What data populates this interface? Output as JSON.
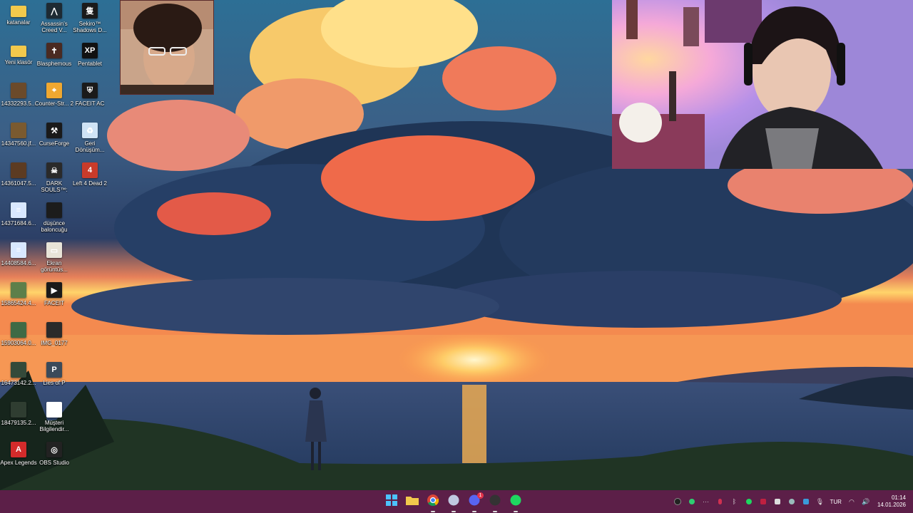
{
  "desktop": {
    "icons_col1": [
      {
        "label": "katanalar",
        "icon": "folder-icon",
        "color": "#f2c94c"
      },
      {
        "label": "Yeni klasör",
        "icon": "folder-icon",
        "color": "#f2c94c"
      },
      {
        "label": "14332293.5...",
        "icon": "image-file-icon",
        "color": "#6b4a2a"
      },
      {
        "label": "14347560.jf...",
        "icon": "image-file-icon",
        "color": "#7a5a30"
      },
      {
        "label": "14361047.5...",
        "icon": "image-file-icon",
        "color": "#5c3b22"
      },
      {
        "label": "14371684.6...",
        "icon": "document-icon",
        "color": "#d9e8ff"
      },
      {
        "label": "14408584.6...",
        "icon": "document-icon",
        "color": "#d9e8ff"
      },
      {
        "label": "15865424.4...",
        "icon": "image-file-icon",
        "color": "#5d7f4a"
      },
      {
        "label": "15903064.0...",
        "icon": "image-file-icon",
        "color": "#3f6a45"
      },
      {
        "label": "16473142.2...",
        "icon": "image-file-icon",
        "color": "#344a3a"
      },
      {
        "label": "18479135.2...",
        "icon": "image-file-icon",
        "color": "#2f3d31"
      },
      {
        "label": "Apex Legends",
        "icon": "apex-legends-icon",
        "color": "#d42b2b"
      }
    ],
    "icons_col2": [
      {
        "label": "Assassin's Creed V...",
        "icon": "assassins-creed-icon",
        "color": "#1e2a33"
      },
      {
        "label": "Blasphemous",
        "icon": "blasphemous-icon",
        "color": "#4a2a22"
      },
      {
        "label": "Counter-Str... 2",
        "icon": "counter-strike-icon",
        "color": "#f0a830"
      },
      {
        "label": "CurseForge",
        "icon": "curseforge-icon",
        "color": "#1a1a1a"
      },
      {
        "label": "DARK SOULS™: RE...",
        "icon": "dark-souls-icon",
        "color": "#2a2a2a"
      },
      {
        "label": "düşünce baloncuğu",
        "icon": "image-file-icon",
        "color": "#1c1c1c"
      },
      {
        "label": "Ekran görüntüs...",
        "icon": "screenshot-file-icon",
        "color": "#e8e4d8"
      },
      {
        "label": "FACEIT",
        "icon": "faceit-icon",
        "color": "#1a1a1a"
      },
      {
        "label": "IMG_0177",
        "icon": "image-file-icon",
        "color": "#2a2a2a"
      },
      {
        "label": "Lies of P",
        "icon": "lies-of-p-icon",
        "color": "#3a4a5a"
      },
      {
        "label": "Müşteri Bilgilendir...",
        "icon": "document-icon",
        "color": "#ffffff"
      },
      {
        "label": "OBS Studio",
        "icon": "obs-studio-icon",
        "color": "#222222"
      }
    ],
    "icons_col3": [
      {
        "label": "Sekiro™ Shadows D...",
        "icon": "sekiro-icon",
        "color": "#1a1a1a"
      },
      {
        "label": "Pentablet",
        "icon": "pentablet-icon",
        "color": "#111111"
      },
      {
        "label": "FACEIT AC",
        "icon": "faceit-ac-icon",
        "color": "#1a1a1a"
      },
      {
        "label": "Geri Dönüşüm...",
        "icon": "recycle-bin-icon",
        "color": "#cfe3f5"
      },
      {
        "label": "Left 4 Dead 2",
        "icon": "left4dead2-icon",
        "color": "#c93b2a"
      }
    ]
  },
  "taskbar": {
    "apps": [
      {
        "name": "start",
        "icon": "windows-start-icon",
        "color": "#4cc2ff"
      },
      {
        "name": "file-explorer",
        "icon": "folder-icon",
        "color": "#f2c94c"
      },
      {
        "name": "chrome",
        "icon": "chrome-icon",
        "color": "#4285f4"
      },
      {
        "name": "app",
        "icon": "puzzle-app-icon",
        "color": "#c0c8e0"
      },
      {
        "name": "discord",
        "icon": "discord-icon",
        "color": "#5865f2",
        "badge": "1"
      },
      {
        "name": "obs",
        "icon": "obs-studio-icon",
        "color": "#333333"
      },
      {
        "name": "spotify",
        "icon": "spotify-icon",
        "color": "#1ed760"
      }
    ],
    "tray_language": "TUR",
    "time": "01:14",
    "date": "14.01.2026"
  }
}
